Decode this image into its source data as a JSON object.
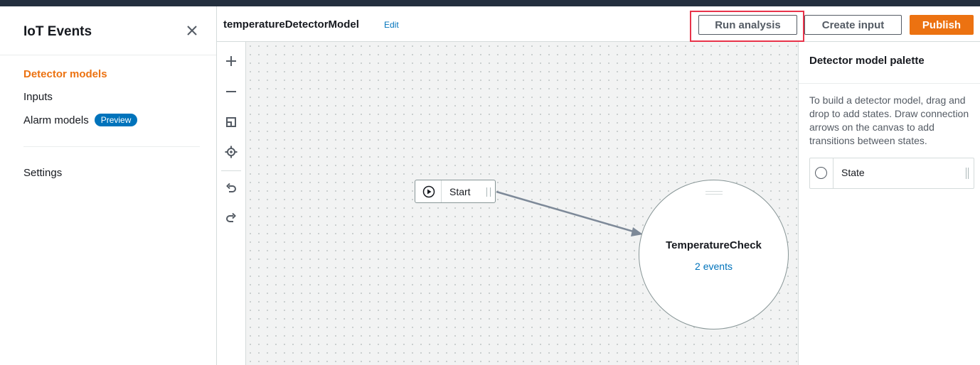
{
  "sidebar": {
    "title": "IoT Events",
    "items": [
      {
        "label": "Detector models",
        "active": true
      },
      {
        "label": "Inputs"
      },
      {
        "label": "Alarm models",
        "badge": "Preview"
      },
      {
        "label": "Settings"
      }
    ]
  },
  "header": {
    "model_name": "temperatureDetectorModel",
    "edit_label": "Edit",
    "run_analysis_label": "Run analysis",
    "create_input_label": "Create input",
    "publish_label": "Publish"
  },
  "toolbar": {
    "icons": [
      "zoom-in-icon",
      "zoom-out-icon",
      "fit-to-screen-icon",
      "center-icon",
      "undo-icon",
      "redo-icon"
    ]
  },
  "canvas": {
    "start_label": "Start",
    "state": {
      "name": "TemperatureCheck",
      "events": "2 events"
    }
  },
  "palette": {
    "title": "Detector model palette",
    "description": "To build a detector model, drag and drop to add states. Draw connection arrows on the canvas to add transitions between states.",
    "items": [
      {
        "label": "State"
      }
    ]
  },
  "colors": {
    "accent": "#ec7211",
    "link": "#0073bb",
    "highlight": "#e8334a",
    "header": "#232f3e"
  }
}
